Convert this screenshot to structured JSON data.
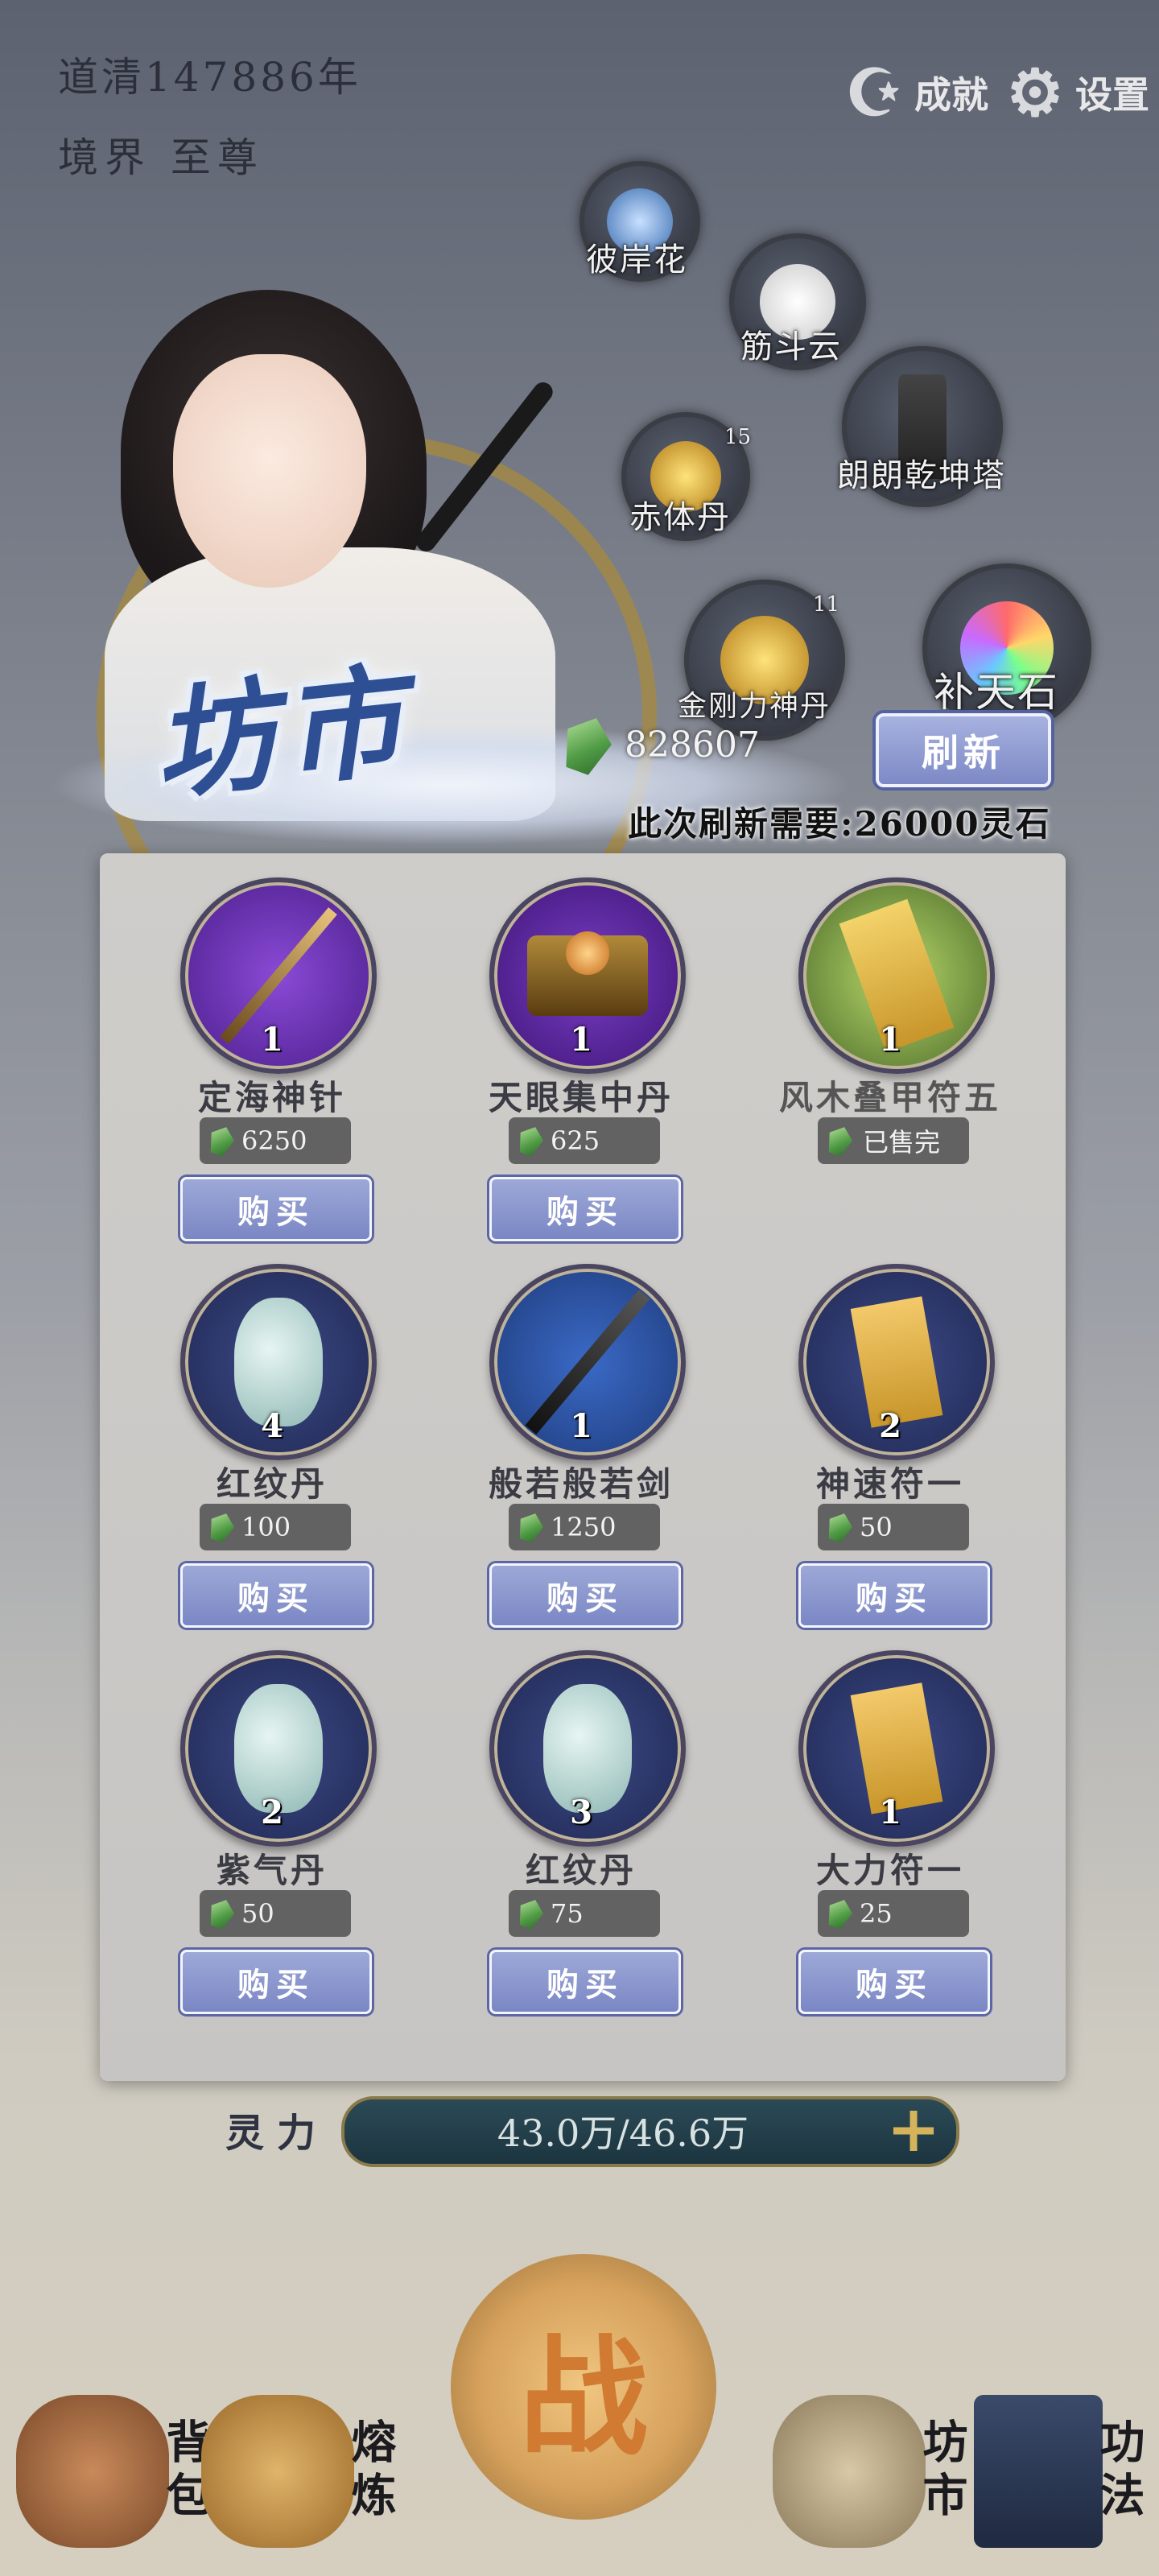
{
  "header": {
    "era": "道清147886年",
    "realm": "境界 至尊",
    "achievements_label": "成就",
    "settings_label": "设置"
  },
  "map": {
    "nodes": [
      {
        "label": "彼岸花",
        "count": ""
      },
      {
        "label": "筋斗云",
        "count": ""
      },
      {
        "label": "朗朗乾坤塔",
        "count": ""
      },
      {
        "label": "赤体丹",
        "count": "15"
      },
      {
        "label": "金刚力神丹",
        "count": "11"
      },
      {
        "label": "补天石",
        "count": ""
      }
    ]
  },
  "market": {
    "title": "坊市",
    "spirit_stones": "828607",
    "refresh_label": "刷新",
    "refresh_cost": "此次刷新需要:26000灵石",
    "items": [
      {
        "name": "定海神针",
        "qty": "1",
        "price": "6250",
        "action": "购买",
        "icon": "staff-icon"
      },
      {
        "name": "天眼集中丹",
        "qty": "1",
        "price": "625",
        "action": "购买",
        "icon": "treasure-chest-icon"
      },
      {
        "name": "风木叠甲符五",
        "qty": "1",
        "price": "已售完",
        "action": "",
        "icon": "talisman-icon"
      },
      {
        "name": "红纹丹",
        "qty": "4",
        "price": "100",
        "action": "购买",
        "icon": "pill-vase-icon"
      },
      {
        "name": "般若般若剑",
        "qty": "1",
        "price": "1250",
        "action": "购买",
        "icon": "sword-icon"
      },
      {
        "name": "神速符一",
        "qty": "2",
        "price": "50",
        "action": "购买",
        "icon": "scroll-talisman-icon"
      },
      {
        "name": "紫气丹",
        "qty": "2",
        "price": "50",
        "action": "购买",
        "icon": "pill-vase-icon"
      },
      {
        "name": "红纹丹",
        "qty": "3",
        "price": "75",
        "action": "购买",
        "icon": "pill-vase-icon"
      },
      {
        "name": "大力符一",
        "qty": "1",
        "price": "25",
        "action": "购买",
        "icon": "scroll-talisman-icon"
      }
    ]
  },
  "spirit_power": {
    "label": "灵力",
    "value": "43.0万/46.6万",
    "current": 43.0,
    "max": 46.6
  },
  "battle": {
    "label": "战"
  },
  "nav": [
    {
      "label": "背包",
      "icon": "bag-icon"
    },
    {
      "label": "熔炼",
      "icon": "furnace-icon"
    },
    {
      "label": "坊市",
      "icon": "scroll-map-icon"
    },
    {
      "label": "功法",
      "icon": "book-icon"
    }
  ],
  "colors": {
    "accent_blue": "#7d89c5",
    "title_blue": "#2f4f95",
    "gold": "#a88a3e",
    "stone_green": "#4f9a44"
  }
}
